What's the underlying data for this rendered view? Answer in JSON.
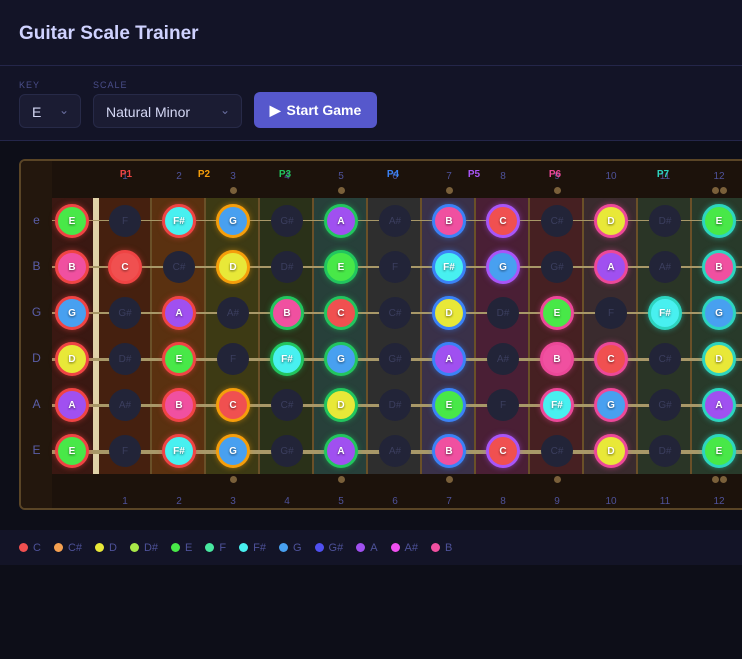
{
  "header": {
    "title": "Guitar Scale Trainer"
  },
  "controls": {
    "key_label": "KEY",
    "key_value": "E",
    "scale_label": "SCALE",
    "scale_value": "Natural Minor",
    "start_icon": "play-icon",
    "start_label": "Start Game"
  },
  "fretboard": {
    "strings": [
      "e",
      "B",
      "G",
      "D",
      "A",
      "E"
    ],
    "rows": [
      [
        "E",
        "F",
        "F#",
        "G",
        "G#",
        "A",
        "A#",
        "B",
        "C",
        "C#",
        "D",
        "D#",
        "E"
      ],
      [
        "B",
        "C",
        "C#",
        "D",
        "D#",
        "E",
        "F",
        "F#",
        "G",
        "G#",
        "A",
        "A#",
        "B"
      ],
      [
        "G",
        "G#",
        "A",
        "A#",
        "B",
        "C",
        "C#",
        "D",
        "D#",
        "E",
        "F",
        "F#",
        "G"
      ],
      [
        "D",
        "D#",
        "E",
        "F",
        "F#",
        "G",
        "G#",
        "A",
        "A#",
        "B",
        "C",
        "C#",
        "D"
      ],
      [
        "A",
        "A#",
        "B",
        "C",
        "C#",
        "D",
        "D#",
        "E",
        "F",
        "F#",
        "G",
        "G#",
        "A"
      ],
      [
        "E",
        "F",
        "F#",
        "G",
        "G#",
        "A",
        "A#",
        "B",
        "C",
        "C#",
        "D",
        "D#",
        "E"
      ]
    ],
    "scale_notes": [
      "E",
      "F#",
      "G",
      "A",
      "B",
      "C",
      "D"
    ],
    "fret_numbers": [
      "1",
      "2",
      "3",
      "4",
      "5",
      "6",
      "7",
      "8",
      "9",
      "10",
      "11",
      "12"
    ],
    "inlay_frets": [
      3,
      5,
      7,
      9,
      12
    ],
    "positions": [
      {
        "label": "P1",
        "color": "#ef4444"
      },
      {
        "label": "P2",
        "color": "#f59e0b"
      },
      {
        "label": "P3",
        "color": "#22c55e"
      },
      {
        "label": "P4",
        "color": "#3b82f6"
      },
      {
        "label": "P5",
        "color": "#a855f7"
      },
      {
        "label": "P6",
        "color": "#ec4899"
      },
      {
        "label": "P7",
        "color": "#2dd4bf"
      }
    ]
  },
  "legend": [
    {
      "note": "C",
      "color": "#f05050"
    },
    {
      "note": "C#",
      "color": "#f5a050"
    },
    {
      "note": "D",
      "color": "#e8e838"
    },
    {
      "note": "D#",
      "color": "#a8e848"
    },
    {
      "note": "E",
      "color": "#48e848"
    },
    {
      "note": "F",
      "color": "#48e8a0"
    },
    {
      "note": "F#",
      "color": "#48f0f0"
    },
    {
      "note": "G",
      "color": "#48a0f0"
    },
    {
      "note": "G#",
      "color": "#5050f0"
    },
    {
      "note": "A",
      "color": "#a050f0"
    },
    {
      "note": "A#",
      "color": "#f050f0"
    },
    {
      "note": "B",
      "color": "#f050a0"
    }
  ]
}
